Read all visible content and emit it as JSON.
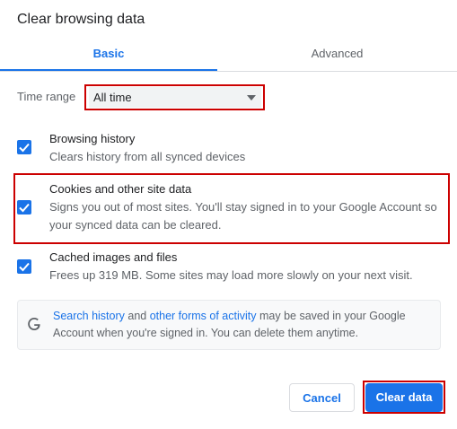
{
  "dialog": {
    "title": "Clear browsing data"
  },
  "tabs": [
    {
      "label": "Basic",
      "active": true
    },
    {
      "label": "Advanced",
      "active": false
    }
  ],
  "time_range": {
    "label": "Time range",
    "value": "All time"
  },
  "items": [
    {
      "title": "Browsing history",
      "desc": "Clears history from all synced devices",
      "checked": true
    },
    {
      "title": "Cookies and other site data",
      "desc_line1": "Signs you out of most sites. You'll stay signed in to your Google Account so",
      "desc_line2": "your synced data can be cleared.",
      "checked": true
    },
    {
      "title": "Cached images and files",
      "desc": "Frees up 319 MB. Some sites may load more slowly on your next visit.",
      "checked": true
    }
  ],
  "info": {
    "link1": "Search history",
    "and": " and ",
    "link2": "other forms of activity",
    "rest": " may be saved in your Google Account when you're signed in. You can delete them anytime."
  },
  "buttons": {
    "cancel": "Cancel",
    "clear": "Clear data"
  },
  "colors": {
    "accent": "#1a73e8",
    "highlight": "#cc0000",
    "text": "#202124",
    "secondary": "#5f6368"
  }
}
